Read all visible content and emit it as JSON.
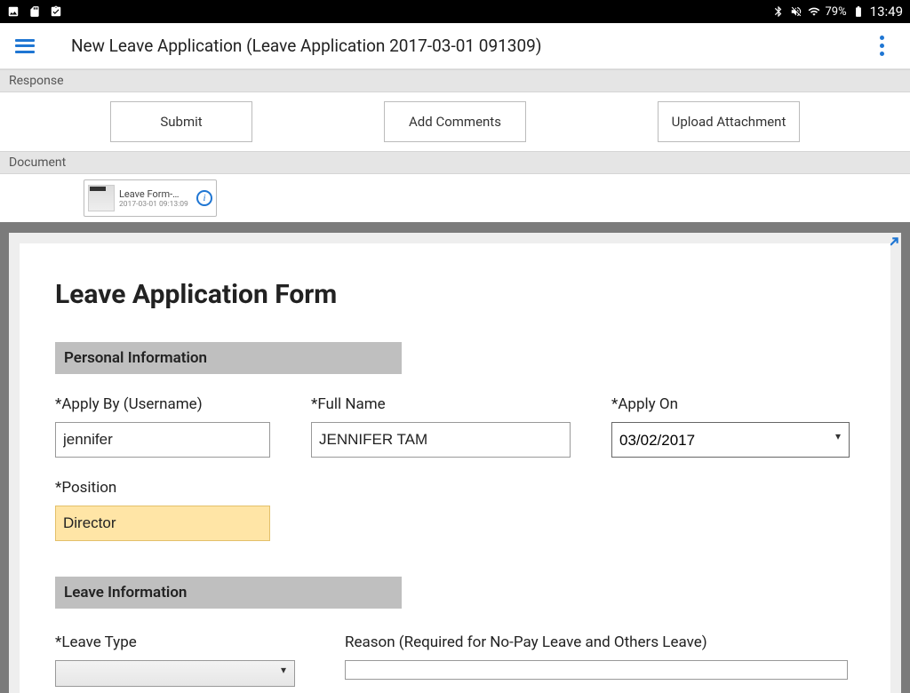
{
  "status": {
    "battery": "79%",
    "time": "13:49"
  },
  "appbar": {
    "title": "New Leave Application (Leave Application 2017-03-01 091309)"
  },
  "sections": {
    "response": "Response",
    "document": "Document"
  },
  "actions": {
    "submit": "Submit",
    "add_comments": "Add Comments",
    "upload": "Upload Attachment"
  },
  "doc_card": {
    "title": "Leave Form-…",
    "date": "2017-03-01 09:13:09"
  },
  "form": {
    "heading": "Leave Application Form",
    "personal_header": "Personal Information",
    "labels": {
      "apply_by": "*Apply By (Username)",
      "full_name": "*Full Name",
      "apply_on": "*Apply On",
      "position": "*Position",
      "leave_type": "*Leave Type",
      "reason": "Reason (Required for No-Pay Leave and Others Leave)"
    },
    "values": {
      "apply_by": "jennifer",
      "full_name": "JENNIFER TAM",
      "apply_on": "03/02/2017",
      "position": "Director"
    },
    "leave_header": "Leave Information"
  }
}
